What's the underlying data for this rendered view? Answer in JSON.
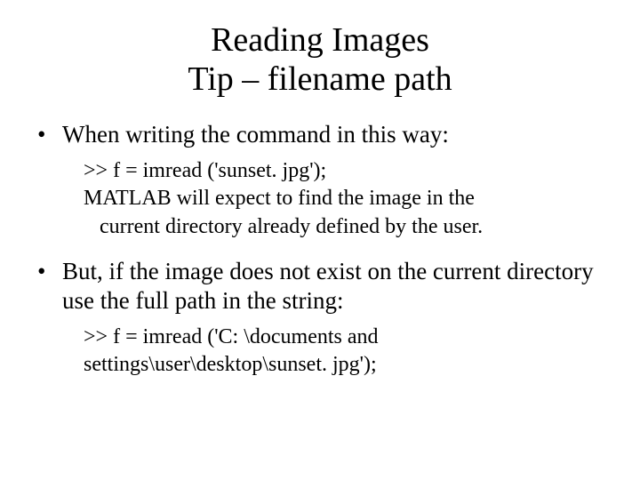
{
  "title_line1": "Reading Images",
  "title_line2": "Tip – filename path",
  "bullets": [
    {
      "text": "When writing the command in this way:",
      "sub": {
        "line1": ">> f = imread ('sunset. jpg');",
        "line2": "MATLAB will expect to find the image in the",
        "line3": "current directory already defined by the user."
      }
    },
    {
      "text": "But, if the image does not exist on the current directory use the full path in the string:",
      "sub": {
        "line1": ">> f = imread ('C: \\documents and settings\\user\\desktop\\sunset. jpg');"
      }
    }
  ]
}
